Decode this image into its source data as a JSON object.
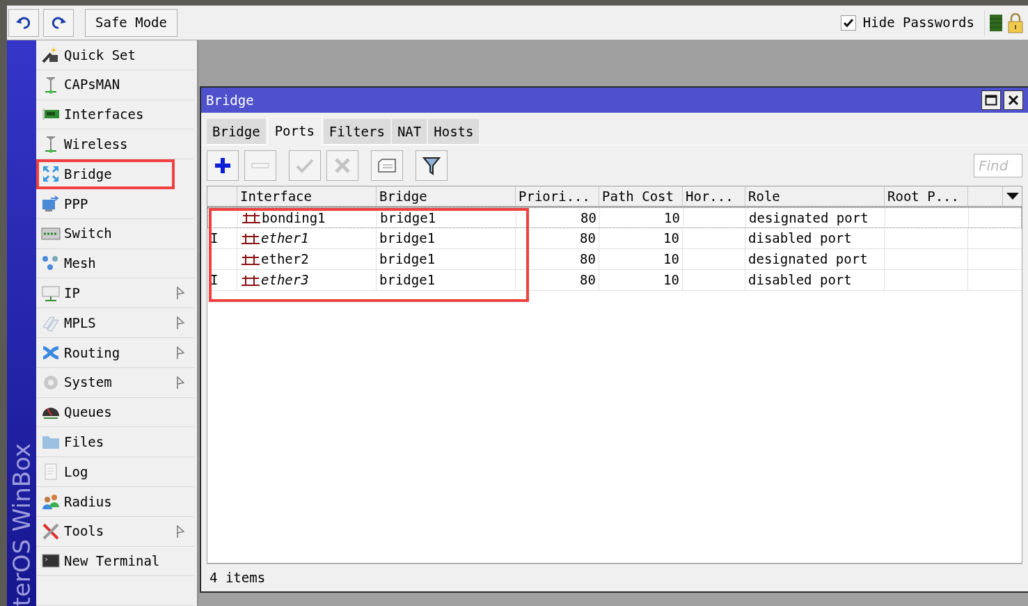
{
  "toolbar": {
    "safe_mode": "Safe Mode",
    "hide_passwords": {
      "label": "Hide Passwords",
      "checked": true
    }
  },
  "brand": "terOS WinBox",
  "sidebar": {
    "items": [
      {
        "label": "Quick Set",
        "submenu": false,
        "highlighted": false
      },
      {
        "label": "CAPsMAN",
        "submenu": false,
        "highlighted": false
      },
      {
        "label": "Interfaces",
        "submenu": false,
        "highlighted": false
      },
      {
        "label": "Wireless",
        "submenu": false,
        "highlighted": false
      },
      {
        "label": "Bridge",
        "submenu": false,
        "highlighted": true
      },
      {
        "label": "PPP",
        "submenu": false,
        "highlighted": false
      },
      {
        "label": "Switch",
        "submenu": false,
        "highlighted": false
      },
      {
        "label": "Mesh",
        "submenu": false,
        "highlighted": false
      },
      {
        "label": "IP",
        "submenu": true,
        "highlighted": false
      },
      {
        "label": "MPLS",
        "submenu": true,
        "highlighted": false
      },
      {
        "label": "Routing",
        "submenu": true,
        "highlighted": false
      },
      {
        "label": "System",
        "submenu": true,
        "highlighted": false
      },
      {
        "label": "Queues",
        "submenu": false,
        "highlighted": false
      },
      {
        "label": "Files",
        "submenu": false,
        "highlighted": false
      },
      {
        "label": "Log",
        "submenu": false,
        "highlighted": false
      },
      {
        "label": "Radius",
        "submenu": false,
        "highlighted": false
      },
      {
        "label": "Tools",
        "submenu": true,
        "highlighted": false
      },
      {
        "label": "New Terminal",
        "submenu": false,
        "highlighted": false
      }
    ]
  },
  "window": {
    "title": "Bridge",
    "tabs": [
      {
        "label": "Bridge",
        "selected": false
      },
      {
        "label": "Ports",
        "selected": true
      },
      {
        "label": "Filters",
        "selected": false
      },
      {
        "label": "NAT",
        "selected": false
      },
      {
        "label": "Hosts",
        "selected": false
      }
    ],
    "find": {
      "placeholder": "Find"
    },
    "table": {
      "marked": true,
      "columns": [
        "Interface",
        "Bridge",
        "Priori...",
        "Path Cost",
        "Hor...",
        "Role",
        "Root P..."
      ],
      "rows": [
        {
          "flag": "",
          "interface": "bonding1",
          "inactive": false,
          "focused": true,
          "bridge": "bridge1",
          "priority": "80",
          "path_cost": "10",
          "role": "designated port"
        },
        {
          "flag": "I",
          "interface": "ether1",
          "inactive": true,
          "focused": false,
          "bridge": "bridge1",
          "priority": "80",
          "path_cost": "10",
          "role": "disabled port"
        },
        {
          "flag": "",
          "interface": "ether2",
          "inactive": false,
          "focused": false,
          "bridge": "bridge1",
          "priority": "80",
          "path_cost": "10",
          "role": "designated port"
        },
        {
          "flag": "I",
          "interface": "ether3",
          "inactive": true,
          "focused": false,
          "bridge": "bridge1",
          "priority": "80",
          "path_cost": "10",
          "role": "disabled port"
        }
      ]
    },
    "status": "4 items"
  }
}
